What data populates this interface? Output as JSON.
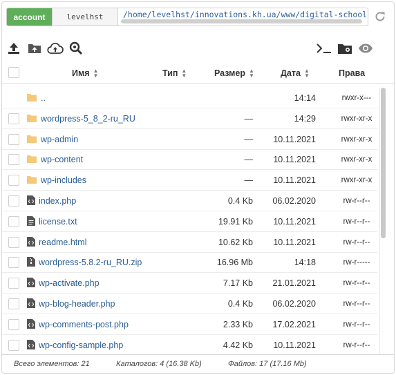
{
  "pathbar": {
    "account_label": "account",
    "user": "levelhst",
    "path": "/home/levelhst/innovations.kh.ua/www/digital-school"
  },
  "toolbar": {
    "left_icons": [
      "upload-icon",
      "upload-folder-icon",
      "cloud-upload-icon",
      "search-icon"
    ],
    "right_icons": [
      "terminal-icon",
      "folder-video-icon",
      "eye-icon"
    ],
    "refresh_icon": "refresh-icon"
  },
  "columns": {
    "name": "Имя",
    "type": "Тип",
    "size": "Размер",
    "date": "Дата",
    "perms": "Права"
  },
  "rows": [
    {
      "kind": "folder",
      "name": "..",
      "size": "",
      "date": "14:14",
      "perms": "rwxr-x---",
      "checkbox": false
    },
    {
      "kind": "folder",
      "name": "wordpress-5_8_2-ru_RU",
      "size": "—",
      "date": "14:29",
      "perms": "rwxr-xr-x",
      "checkbox": true
    },
    {
      "kind": "folder",
      "name": "wp-admin",
      "size": "—",
      "date": "10.11.2021",
      "perms": "rwxr-xr-x",
      "checkbox": true
    },
    {
      "kind": "folder",
      "name": "wp-content",
      "size": "—",
      "date": "10.11.2021",
      "perms": "rwxr-xr-x",
      "checkbox": true
    },
    {
      "kind": "folder",
      "name": "wp-includes",
      "size": "—",
      "date": "10.11.2021",
      "perms": "rwxr-xr-x",
      "checkbox": true
    },
    {
      "kind": "code",
      "name": "index.php",
      "size": "0.4 Kb",
      "date": "06.02.2020",
      "perms": "rw-r--r--",
      "checkbox": true
    },
    {
      "kind": "text",
      "name": "license.txt",
      "size": "19.91 Kb",
      "date": "10.11.2021",
      "perms": "rw-r--r--",
      "checkbox": true
    },
    {
      "kind": "code",
      "name": "readme.html",
      "size": "10.62 Kb",
      "date": "10.11.2021",
      "perms": "rw-r--r--",
      "checkbox": true
    },
    {
      "kind": "zip",
      "name": "wordpress-5.8.2-ru_RU.zip",
      "size": "16.96 Mb",
      "date": "14:18",
      "perms": "rw-r-----",
      "checkbox": true
    },
    {
      "kind": "code",
      "name": "wp-activate.php",
      "size": "7.17 Kb",
      "date": "21.01.2021",
      "perms": "rw-r--r--",
      "checkbox": true
    },
    {
      "kind": "code",
      "name": "wp-blog-header.php",
      "size": "0.4 Kb",
      "date": "06.02.2020",
      "perms": "rw-r--r--",
      "checkbox": true
    },
    {
      "kind": "code",
      "name": "wp-comments-post.php",
      "size": "2.33 Kb",
      "date": "17.02.2021",
      "perms": "rw-r--r--",
      "checkbox": true
    },
    {
      "kind": "code",
      "name": "wp-config-sample.php",
      "size": "4.42 Kb",
      "date": "10.11.2021",
      "perms": "rw-r--r--",
      "checkbox": true
    }
  ],
  "footer": {
    "total": "Всего элементов: 21",
    "dirs": "Каталогов: 4 (16.38 Kb)",
    "files": "Файлов: 17 (17.16 Mb)"
  },
  "colors": {
    "accent": "#5fae5a",
    "link": "#2a5d94",
    "folder": "#f5c87a"
  }
}
